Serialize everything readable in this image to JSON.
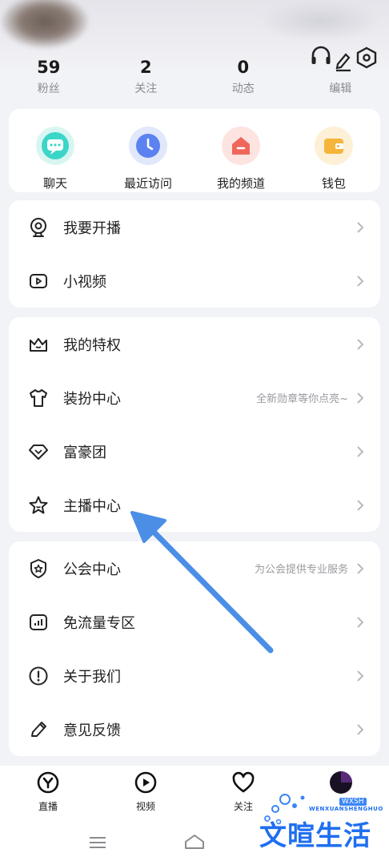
{
  "stats": [
    {
      "value": "59",
      "label": "粉丝"
    },
    {
      "value": "2",
      "label": "关注"
    },
    {
      "value": "0",
      "label": "动态"
    },
    {
      "value": "",
      "label": "编辑"
    }
  ],
  "quick_actions": [
    {
      "label": "聊天",
      "icon": "chat-bubble-icon",
      "color": "#33d1c4"
    },
    {
      "label": "最近访问",
      "icon": "clock-icon",
      "color": "#5b82f0"
    },
    {
      "label": "我的频道",
      "icon": "channel-house-icon",
      "color": "#f0665a"
    },
    {
      "label": "钱包",
      "icon": "wallet-icon",
      "color": "#f5b53a"
    }
  ],
  "menu_group_1": [
    {
      "label": "我要开播",
      "icon": "webcam-icon"
    },
    {
      "label": "小视频",
      "icon": "play-video-icon"
    }
  ],
  "menu_group_2": [
    {
      "label": "我的特权",
      "icon": "crown-icon"
    },
    {
      "label": "装扮中心",
      "icon": "tshirt-icon",
      "sub": "全新勋章等你点亮~"
    },
    {
      "label": "富豪团",
      "icon": "diamond-icon"
    },
    {
      "label": "主播中心",
      "icon": "star-icon"
    }
  ],
  "menu_group_3": [
    {
      "label": "公会中心",
      "icon": "shield-star-icon",
      "sub": "为公会提供专业服务"
    },
    {
      "label": "免流量专区",
      "icon": "signal-bars-icon"
    },
    {
      "label": "关于我们",
      "icon": "info-exclamation-icon"
    },
    {
      "label": "意见反馈",
      "icon": "pencil-icon"
    }
  ],
  "bottom_nav": [
    {
      "label": "直播",
      "icon": "live-y-icon"
    },
    {
      "label": "视频",
      "icon": "video-play-icon"
    },
    {
      "label": "关注",
      "icon": "heart-icon"
    },
    {
      "label": "",
      "icon": "profile-avatar-icon"
    }
  ],
  "watermark": {
    "text": "文暄生活",
    "sub": "WENXUANSHENGHUO",
    "tag": "WXSH"
  },
  "colors": {
    "background": "#f2f3f7",
    "card": "#ffffff",
    "arrow": "#4a8ee6",
    "text_secondary": "#9a9aa0"
  }
}
